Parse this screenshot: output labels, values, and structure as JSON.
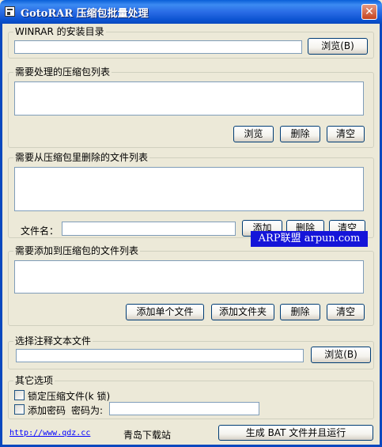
{
  "window": {
    "title": "GotoRAR 压缩包批量处理",
    "close_glyph": "✕"
  },
  "winrar": {
    "legend": "WINRAR 的安装目录",
    "path_value": "",
    "browse_label": "浏览(B)"
  },
  "archives": {
    "legend": "需要处理的压缩包列表",
    "browse_label": "浏览",
    "delete_label": "删除",
    "clear_label": "清空"
  },
  "delete_files": {
    "legend": "需要从压缩包里删除的文件列表",
    "filename_label": "文件名：",
    "filename_value": "",
    "add_label": "添加",
    "delete_label": "删除",
    "clear_label": "清空"
  },
  "add_files": {
    "legend": "需要添加到压缩包的文件列表",
    "add_file_label": "添加单个文件",
    "add_folder_label": "添加文件夹",
    "delete_label": "删除",
    "clear_label": "清空"
  },
  "comment": {
    "legend": "选择注释文本文件",
    "path_value": "",
    "browse_label": "浏览(B)"
  },
  "options": {
    "legend": "其它选项",
    "lock_label": "锁定压缩文件(k 锁)",
    "lock_checked": false,
    "password_label": "添加密码",
    "password_field_label": "密码为:",
    "password_value": ""
  },
  "footer": {
    "link_text": "http://www.qdz.cc",
    "site_name": "青岛下载站",
    "run_label": "生成 BAT 文件并且运行"
  },
  "watermark": {
    "text": "ARP联盟 arpun.com"
  }
}
